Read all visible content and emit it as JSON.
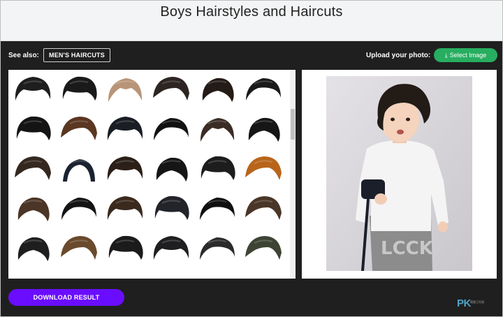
{
  "header": {
    "title": "Boys Hairstyles and Haircuts"
  },
  "toolbar": {
    "see_also_label": "See also:",
    "mens_haircuts_label": "MEN'S HAIRCUTS",
    "upload_label": "Upload your photo:",
    "select_image_label": "Select Image",
    "select_image_icon": "download-icon"
  },
  "colors": {
    "header_bg": "#f3f4f6",
    "app_bg": "#1f1f1f",
    "select_button": "#27ae60",
    "download_button": "#6a0dff"
  },
  "hairstyles": [
    {
      "color": "#1e1e1e",
      "style": 0
    },
    {
      "color": "#1a1a1a",
      "style": 1
    },
    {
      "color": "#b89478",
      "style": 2
    },
    {
      "color": "#2d2521",
      "style": 3
    },
    {
      "color": "#241a16",
      "style": 4
    },
    {
      "color": "#1a1a1a",
      "style": 5
    },
    {
      "color": "#141414",
      "style": 1
    },
    {
      "color": "#5b3621",
      "style": 3
    },
    {
      "color": "#1a1d24",
      "style": 0
    },
    {
      "color": "#121212",
      "style": 5
    },
    {
      "color": "#3b2d25",
      "style": 2
    },
    {
      "color": "#161616",
      "style": 4
    },
    {
      "color": "#35281f",
      "style": 3
    },
    {
      "color": "#1b2230",
      "style": 6
    },
    {
      "color": "#2b1f17",
      "style": 0
    },
    {
      "color": "#151515",
      "style": 4
    },
    {
      "color": "#1d1d1d",
      "style": 1
    },
    {
      "color": "#b8651b",
      "style": 3
    },
    {
      "color": "#4b3526",
      "style": 4
    },
    {
      "color": "#141414",
      "style": 5
    },
    {
      "color": "#3a2a1e",
      "style": 0
    },
    {
      "color": "#22242a",
      "style": 1
    },
    {
      "color": "#101010",
      "style": 5
    },
    {
      "color": "#4a3628",
      "style": 3
    },
    {
      "color": "#1e1e1e",
      "style": 4
    },
    {
      "color": "#6a4a2c",
      "style": 3
    },
    {
      "color": "#1b1b1b",
      "style": 1
    },
    {
      "color": "#1f1f22",
      "style": 0
    },
    {
      "color": "#2b2b2b",
      "style": 5
    },
    {
      "color": "#3e4433",
      "style": 3
    }
  ],
  "scrollbar": {
    "position_fraction": 0.22
  },
  "photo": {
    "subject": "toddler-photo",
    "shirt_text": "LCCK"
  },
  "footer": {
    "download_label": "DOWNLOAD RESULT",
    "watermark": "PK",
    "watermark_sub": "電腦王阿達"
  }
}
